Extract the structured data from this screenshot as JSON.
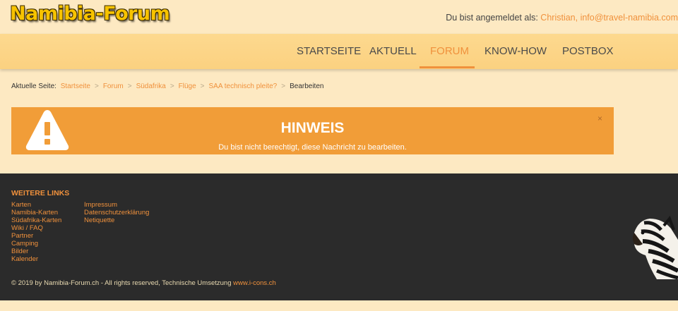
{
  "header": {
    "logo": "Namibia-Forum",
    "user_prefix": "Du bist angemeldet als: ",
    "user_link": "Christian, info@travel-namibia.com"
  },
  "nav": {
    "items": [
      {
        "label": "STARTSEITE"
      },
      {
        "label": "AKTUELL"
      },
      {
        "label": "FORUM",
        "active": true
      },
      {
        "label": "KNOW-HOW"
      },
      {
        "label": "POSTBOX"
      }
    ]
  },
  "breadcrumb": {
    "prefix": "Aktuelle Seite:",
    "items": [
      "Startseite",
      "Forum",
      "Südafrika",
      "Flüge",
      "SAA technisch pleite?"
    ],
    "separator": ">",
    "current": "Bearbeiten"
  },
  "notice": {
    "title": "HINWEIS",
    "text": "Du bist nicht berechtigt, diese Nachricht zu bearbeiten.",
    "close": "×",
    "color": "#f19d38"
  },
  "footer": {
    "title": "WEITERE LINKS",
    "col1": [
      "Karten",
      "Namibia-Karten",
      "Südafrika-Karten",
      "Wiki / FAQ",
      "Partner",
      "Camping",
      "Bilder",
      "Kalender"
    ],
    "col2": [
      "Impressum",
      "Datenschutzerklärung",
      "Netiquette"
    ],
    "copyright": "© 2019 by Namibia-Forum.ch - All rights reserved, Technische Umsetzung ",
    "copyright_link": "www.i-cons.ch"
  },
  "colors": {
    "accent": "#f0913c",
    "background": "#fde9c2",
    "footer_bg": "#2b2b2b"
  },
  "icons": {
    "notice": "warning-triangle-icon",
    "close": "close-icon",
    "mascot": "zebra-image"
  }
}
